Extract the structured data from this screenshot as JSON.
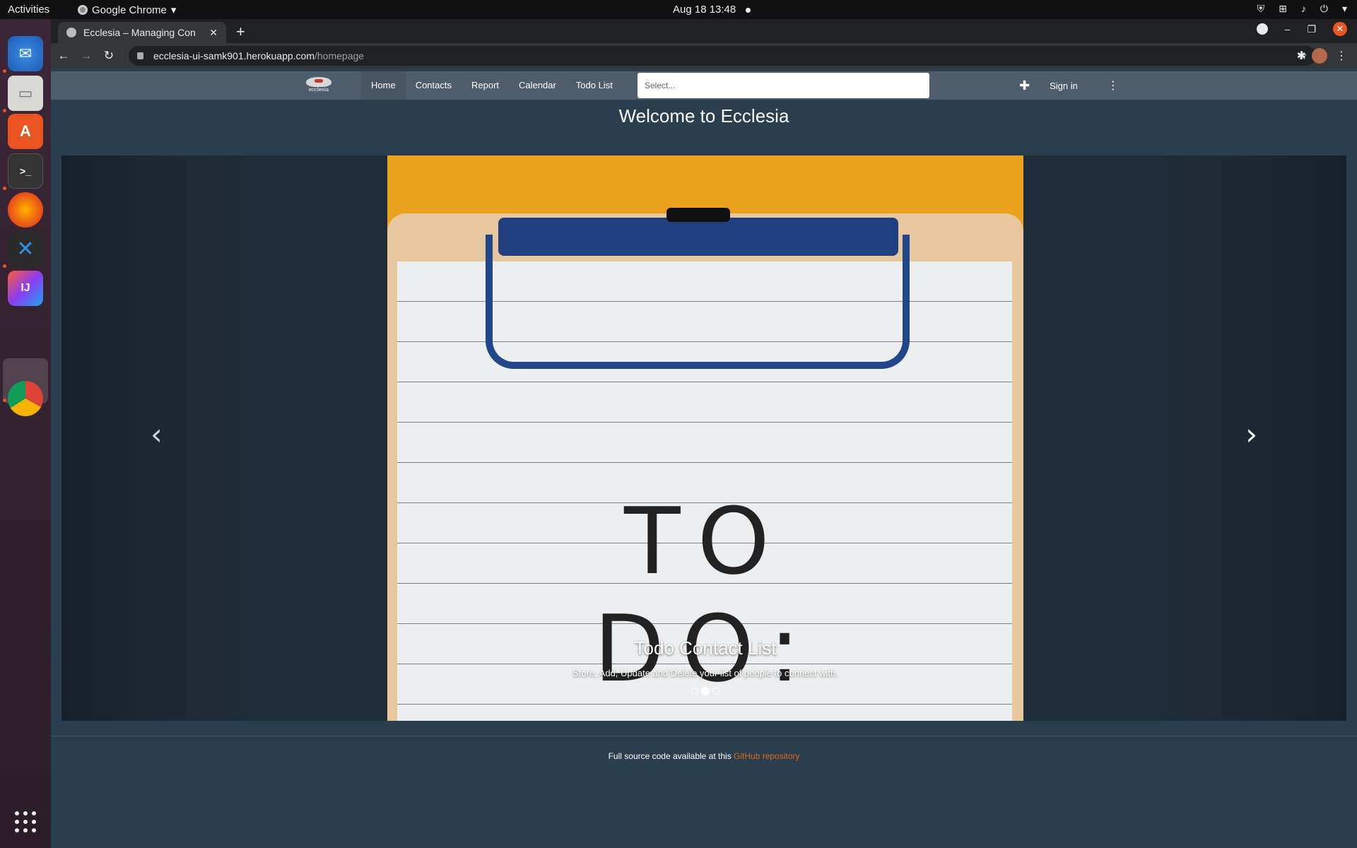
{
  "system": {
    "activities": "Activities",
    "app_menu": "Google Chrome",
    "clock": "Aug 18  13:48"
  },
  "dock": {
    "apps": [
      "thunderbird-icon",
      "files-icon",
      "software-center-icon",
      "terminal-icon",
      "firefox-icon",
      "vscode-icon",
      "intellij-icon",
      "chrome-icon"
    ]
  },
  "browser": {
    "tab_title": "Ecclesia – Managing Con",
    "url_host": "ecclesia-ui-samk901.herokuapp.com",
    "url_path": "/homepage"
  },
  "navbar": {
    "brand": "ecclesia",
    "links": [
      "Home",
      "Contacts",
      "Report",
      "Calendar",
      "Todo List"
    ],
    "active": "Home",
    "select_placeholder": "Select...",
    "signin": "Sign in"
  },
  "main": {
    "welcome": "Welcome to Ecclesia",
    "slide": {
      "image_text": "TO DO:",
      "caption_title": "Todo Contact List",
      "caption_text": "Store, Add, Update and Delete your list of people to connect with.",
      "indicator_count": 3,
      "active_indicator": 2
    }
  },
  "footer": {
    "text": "Full source code available at this",
    "link": "GitHub repository"
  },
  "colors": {
    "page_bg": "#2b3e50",
    "navbar_bg": "#4e5d6c",
    "accent_link": "#df691a",
    "slide_bg": "#eba21f"
  }
}
